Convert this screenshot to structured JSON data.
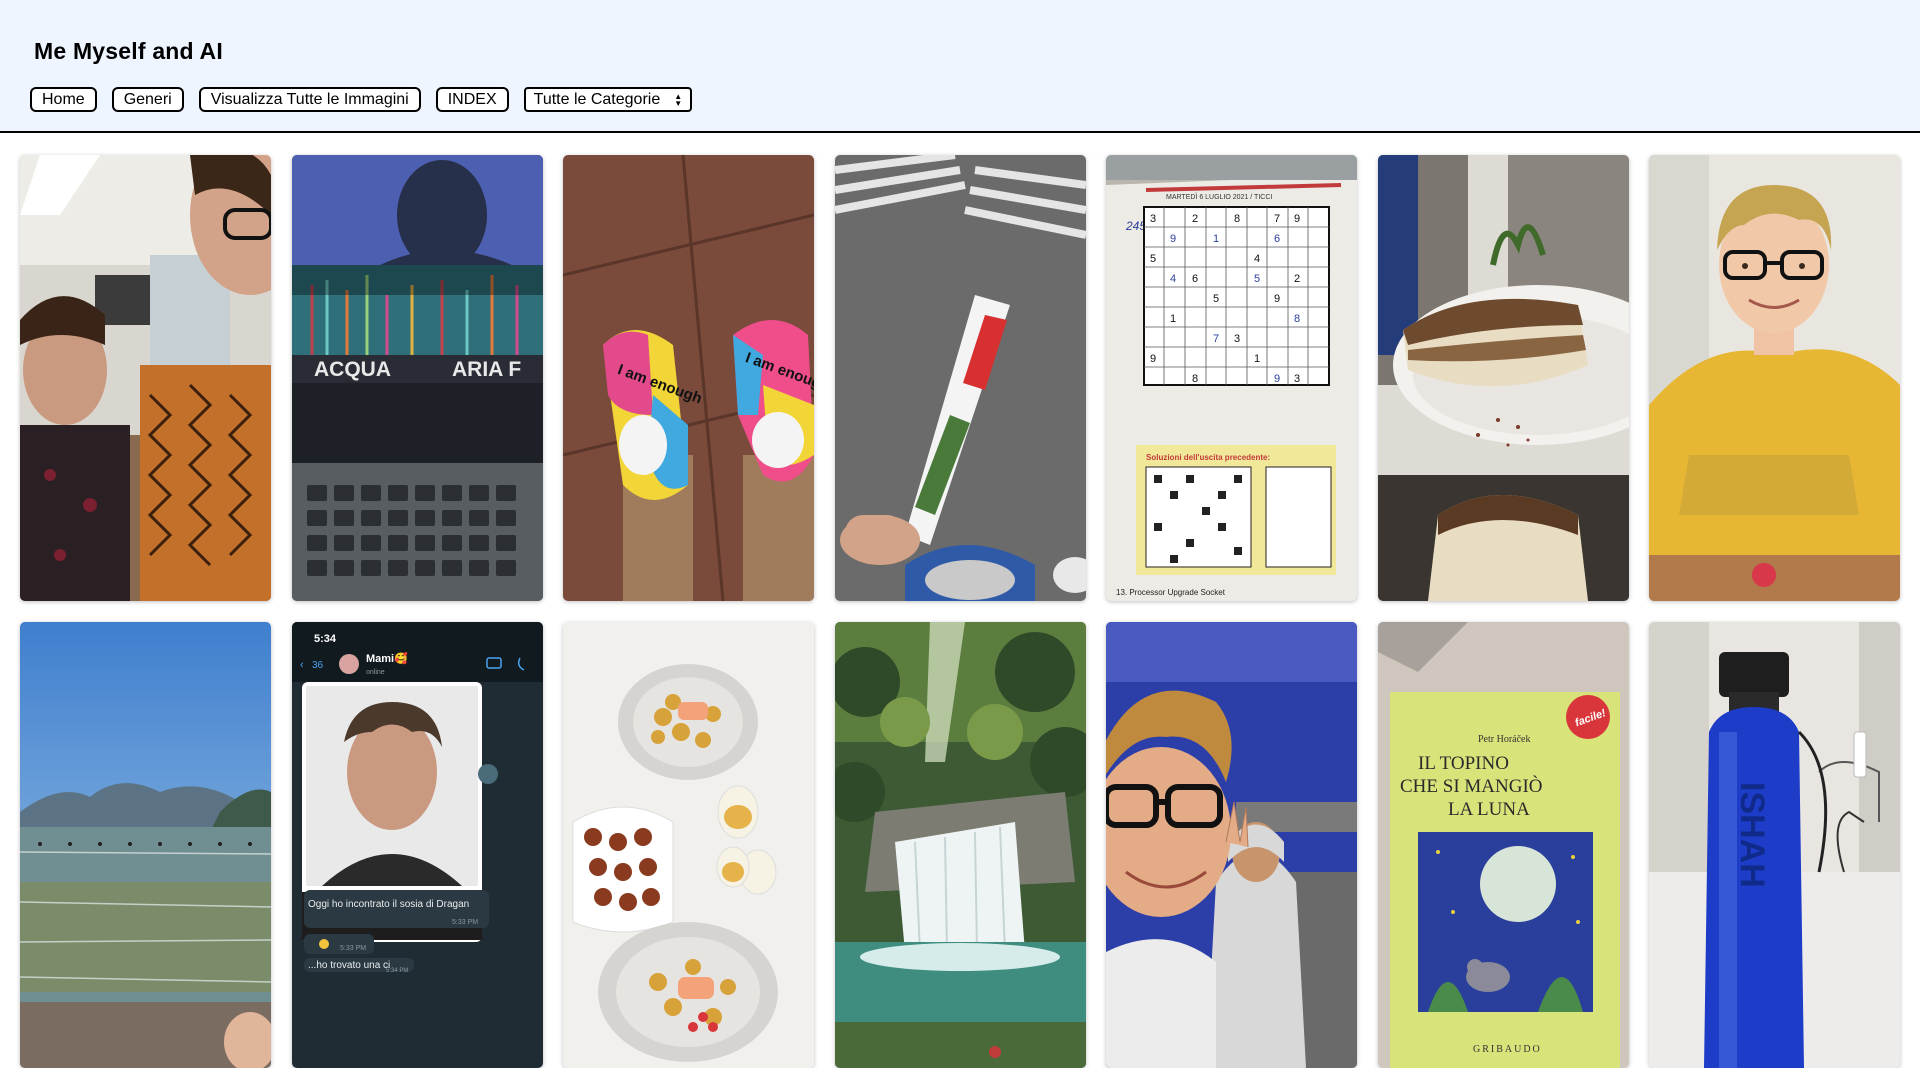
{
  "header": {
    "title": "Me Myself and AI",
    "nav": {
      "home": "Home",
      "genres": "Generi",
      "view_all": "Visualizza Tutte le Immagini",
      "index": "INDEX",
      "category_select": "Tutte le Categorie"
    },
    "background_color": "#eef5ff"
  },
  "gallery": {
    "photos": [
      {
        "subject": "restaurant-selfie"
      },
      {
        "subject": "laptop-screen"
      },
      {
        "subject": "slippers"
      },
      {
        "subject": "ice-cream"
      },
      {
        "subject": "sudoku"
      },
      {
        "subject": "tiramisu"
      },
      {
        "subject": "boy-portrait"
      },
      {
        "subject": "lake"
      },
      {
        "subject": "chat-screenshot"
      },
      {
        "subject": "dinner-plates"
      },
      {
        "subject": "waterfall"
      },
      {
        "subject": "friends-selfie"
      },
      {
        "subject": "book-cover"
      },
      {
        "subject": "water-bottle"
      }
    ],
    "laptop": {
      "line1": "ACQUA",
      "line2": "ARIA F"
    },
    "slippers": {
      "text": "I am enough"
    },
    "sudoku": {
      "header": "MARTEDÌ 6 LUGLIO 2021 / TICCI",
      "solutions": "Soluzioni dell'uscita precedente:",
      "footer": "13. Processor Upgrade Socket"
    },
    "chat": {
      "time": "5:34",
      "back_count": "36",
      "contact": "Mami🥰",
      "status": "online",
      "msg1": "Oggi ho incontrato il sosia di Dragan",
      "msg1_time": "5:33 PM",
      "msg2_time": "5:33 PM",
      "msg3": "...ho trovato una ci",
      "msg3_time": "5:34 PM"
    },
    "book": {
      "author": "Petr Horáček",
      "title1": "IL TOPINO",
      "title2": "CHE SI MANGIÒ",
      "title3": "LA LUNA",
      "badge": "facile!",
      "publisher": "GRIBAUDO"
    },
    "bottle": {
      "text": "ISHAH"
    }
  }
}
